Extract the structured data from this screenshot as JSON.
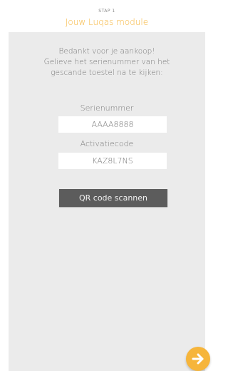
{
  "header": {
    "step_label": "STAP 1",
    "title": "Jouw Luqas module"
  },
  "intro": {
    "line1": "Bedankt voor je aankoop!",
    "line2": "Gelieve het serienummer van het",
    "line3": "gescande toestel na te kijken:"
  },
  "serial": {
    "label": "Serienummer",
    "value": "AAAA8888"
  },
  "activation": {
    "label": "Activatiecode",
    "value": "KAZ8L7NS"
  },
  "actions": {
    "qr_label": "QR code scannen"
  },
  "colors": {
    "accent": "#f6b53b",
    "panel": "#ebebeb",
    "button": "#5c5c5c"
  },
  "icons": {
    "next": "arrow-right-icon"
  }
}
